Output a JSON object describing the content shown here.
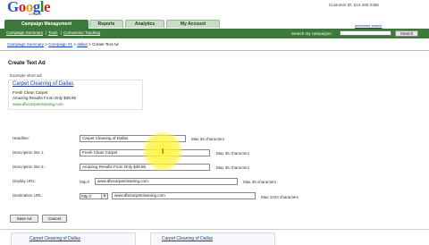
{
  "header": {
    "logo_text": "Google",
    "logo_sub": "AdWords",
    "customer_id": "Customer ID: 514-260-2368",
    "advanced_search": "advanced search"
  },
  "tabs": [
    {
      "label": "Campaign Management",
      "active": true
    },
    {
      "label": "Reports",
      "active": false
    },
    {
      "label": "Analytics",
      "active": false
    },
    {
      "label": "My Account",
      "active": false
    }
  ],
  "subnav": {
    "links": [
      "Campaign Summary",
      "Tools",
      "Conversion Tracking"
    ],
    "search_label": "Search my campaigns:",
    "search_value": "",
    "search_button": "Search"
  },
  "breadcrumb": {
    "items": [
      "Campaign Summary",
      "Campaign #1",
      "dallas"
    ],
    "current": "Create Text Ad",
    "separator": ">"
  },
  "page": {
    "title": "Create Text Ad",
    "example_label": "Example short ad:"
  },
  "example_ad": {
    "headline": "Carpet Cleaning of Dallas",
    "line1": "Fresh Clean Carpet",
    "line2": "Amazing Results From Only $39.95",
    "display_url": "www.dfwcarpetcleaning.com"
  },
  "form": {
    "headline": {
      "label": "Headline:",
      "value": "Carpet Cleaning of Dallas",
      "note": "Max 25 characters"
    },
    "desc1": {
      "label": "Description line 1:",
      "value": "Fresh Clean Carpet",
      "note": "Max 35 characters"
    },
    "desc2": {
      "label": "Description line 2:",
      "value": "Amazing Results From Only $39.95",
      "note": "Max 35 characters"
    },
    "display_url": {
      "label": "Display URL:",
      "prefix": "http://",
      "value": "www.dfwcarpetcleaning.com",
      "note": "Max 35 characters"
    },
    "destination_url": {
      "label": "Destination URL:",
      "protocol": "http://",
      "value": "www.dfwcarpetcleaning.com",
      "note": "Max 1024 characters"
    }
  },
  "buttons": {
    "save": "Save Ad",
    "cancel": "Cancel"
  },
  "preview": {
    "left_headline": "Carpet Cleaning of Dallas",
    "right_headline": "Carpet Cleaning of Dallas"
  },
  "colors": {
    "nav_green": "#3d7a3a",
    "tab_inactive": "#c9dcc6",
    "link_blue": "#1a3fa0",
    "url_green": "#2a8a2a",
    "cursor_highlight": "#fff43c"
  },
  "icons": {
    "cursor": "mouse-cursor-icon",
    "dropdown": "chevron-down-icon"
  }
}
